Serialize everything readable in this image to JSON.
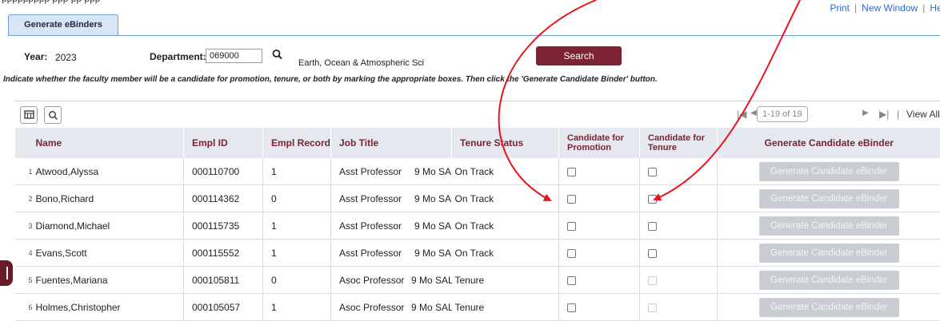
{
  "top_links": {
    "print": "Print",
    "new_window": "New Window",
    "help": "Help"
  },
  "tabs": [
    {
      "label": "Generate eBinders"
    }
  ],
  "form": {
    "year_label": "Year:",
    "year_value": "2023",
    "department_label": "Department:",
    "department_value": "069000",
    "department_name": "Earth, Ocean & Atmospheric Sci",
    "search_label": "Search",
    "instructions": "Indicate whether the faculty member will be a candidate for promotion, tenure, or both by marking the appropriate boxes. Then click the 'Generate Candidate Binder' button."
  },
  "grid": {
    "pager_text": "1-19 of 19",
    "view_all": "View All",
    "columns": {
      "name": "Name",
      "empl_id": "Empl ID",
      "empl_record": "Empl Record",
      "job_title": "Job Title",
      "tenure_status": "Tenure Status",
      "cand_promotion": "Candidate for Promotion",
      "cand_tenure": "Candidate for Tenure",
      "generate": "Generate Candidate eBinder"
    },
    "rows": [
      {
        "num": "1",
        "name": "Atwood,Alyssa",
        "empl_id": "000110700",
        "empl_record": "1",
        "job_title": "Asst Professor",
        "pay": "9 Mo SAL",
        "tenure_status": "On Track",
        "tenure_enabled": true,
        "button": "Generate Candidate eBinder"
      },
      {
        "num": "2",
        "name": "Bono,Richard",
        "empl_id": "000114362",
        "empl_record": "0",
        "job_title": "Asst Professor",
        "pay": "9 Mo SAL",
        "tenure_status": "On Track",
        "tenure_enabled": true,
        "button": "Generate Candidate eBinder"
      },
      {
        "num": "3",
        "name": "Diamond,Michael",
        "empl_id": "000115735",
        "empl_record": "1",
        "job_title": "Asst Professor",
        "pay": "9 Mo SAL",
        "tenure_status": "On Track",
        "tenure_enabled": true,
        "button": "Generate Candidate eBinder"
      },
      {
        "num": "4",
        "name": "Evans,Scott",
        "empl_id": "000115552",
        "empl_record": "1",
        "job_title": "Asst Professor",
        "pay": "9 Mo SAL",
        "tenure_status": "On Track",
        "tenure_enabled": true,
        "button": "Generate Candidate eBinder"
      },
      {
        "num": "5",
        "name": "Fuentes,Mariana",
        "empl_id": "000105811",
        "empl_record": "0",
        "job_title": "Asoc Professor",
        "pay": "9 Mo SAL",
        "tenure_status": "Tenure",
        "tenure_enabled": false,
        "button": "Generate Candidate eBinder"
      },
      {
        "num": "6",
        "name": "Holmes,Christopher",
        "empl_id": "000105057",
        "empl_record": "1",
        "job_title": "Asoc Professor",
        "pay": "9 Mo SAL",
        "tenure_status": "Tenure",
        "tenure_enabled": false,
        "button": "Generate Candidate eBinder"
      }
    ]
  },
  "colors": {
    "accent": "#7a2331",
    "annotation_red": "#e8141c",
    "tab_blue": "#d7e6f7"
  },
  "icons": [
    "lookup-icon",
    "grid-settings-icon",
    "find-icon",
    "first-page-icon",
    "prev-page-icon",
    "next-page-icon",
    "last-page-icon",
    "chevron-down-icon"
  ]
}
